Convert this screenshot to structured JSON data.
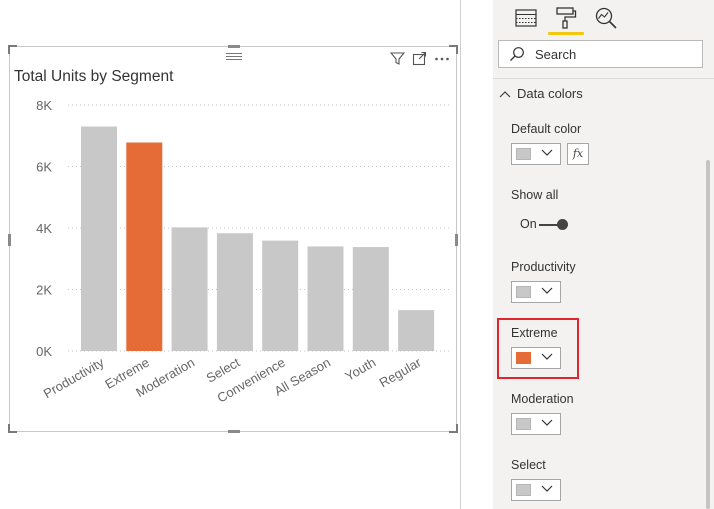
{
  "visual": {
    "title": "Total Units by Segment",
    "tools": [
      "filter-icon",
      "focus-mode-icon",
      "more-options-icon"
    ]
  },
  "chart_data": {
    "type": "bar",
    "title": "Total Units by Segment",
    "categories": [
      "Productivity",
      "Extreme",
      "Moderation",
      "Select",
      "Convenience",
      "All Season",
      "Youth",
      "Regular"
    ],
    "values": [
      7300,
      6780,
      4020,
      3830,
      3590,
      3400,
      3380,
      1330
    ],
    "yticks": [
      "0K",
      "2K",
      "4K",
      "6K",
      "8K"
    ],
    "ylim": [
      0,
      8000
    ],
    "grid": true,
    "colors": {
      "default": "#c8c8c8",
      "Extreme": "#e66c37"
    },
    "highlighted": "Extreme"
  },
  "format_pane": {
    "tabs": [
      "fields-icon",
      "format-paint-roller-icon",
      "analytics-icon"
    ],
    "active_tab": "format-paint-roller-icon",
    "search": {
      "placeholder": "Search",
      "value": ""
    },
    "section": {
      "label": "Data colors",
      "state": "expanded"
    },
    "default_color": {
      "label": "Default color",
      "color": "#c8c8c8",
      "fx_label": "fx"
    },
    "show_all": {
      "label": "Show all",
      "state_label": "On"
    },
    "series": [
      {
        "label": "Productivity",
        "color": "#c8c8c8"
      },
      {
        "label": "Extreme",
        "color": "#e66c37",
        "highlighted": true
      },
      {
        "label": "Moderation",
        "color": "#c8c8c8"
      },
      {
        "label": "Select",
        "color": "#c8c8c8"
      }
    ],
    "highlight_color": "#e0262d",
    "tab_underline_color": "#f2c811"
  }
}
